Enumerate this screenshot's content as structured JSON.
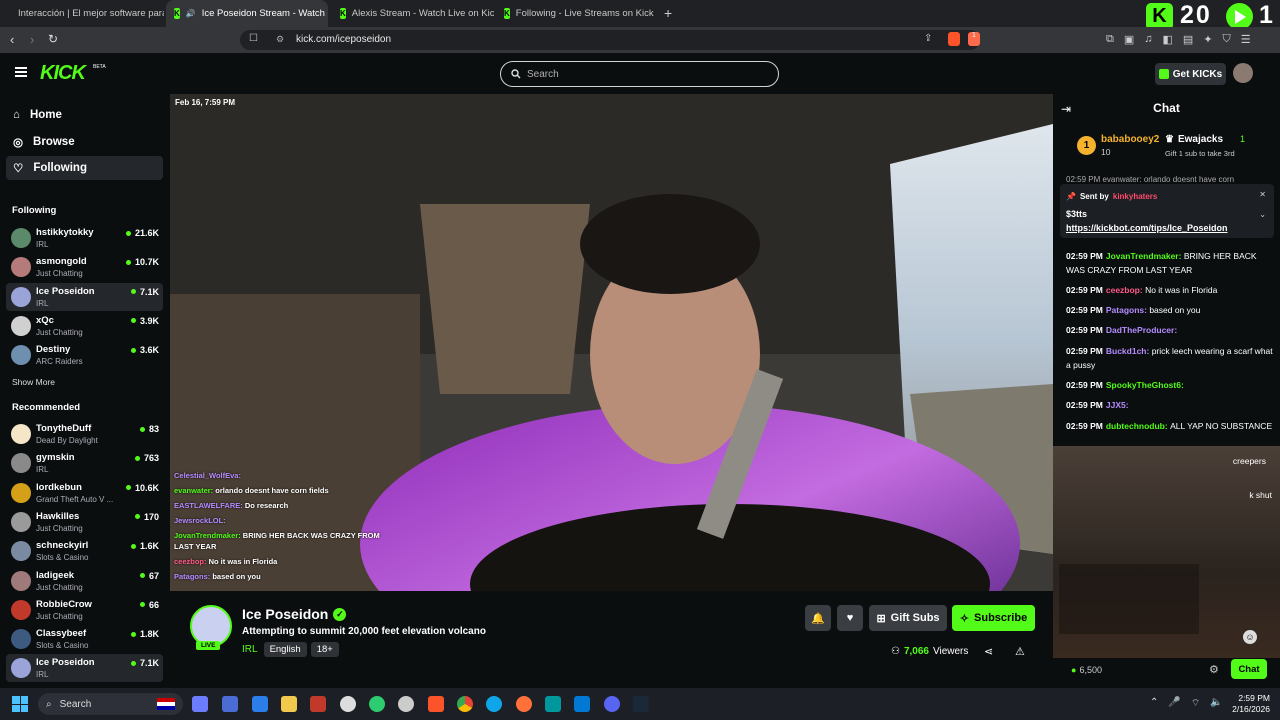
{
  "tabs": [
    {
      "title": "Interacción | El mejor software para y"
    },
    {
      "title": "Ice Poseidon Stream - Watch"
    },
    {
      "title": "Alexis Stream - Watch Live on Kick"
    },
    {
      "title": "Following - Live Streams on Kick"
    }
  ],
  "overlay_counter": "20",
  "overlay_counter2": "1",
  "url": "kick.com/iceposeidon",
  "ext_badge": "1",
  "site": {
    "logo": "KICK",
    "logo_sup": "BETA",
    "search_placeholder": "Search",
    "get_kicks": "Get KICKs"
  },
  "nav": {
    "home": "Home",
    "browse": "Browse",
    "following": "Following"
  },
  "following_title": "Following",
  "following": [
    {
      "name": "hstikkytokky",
      "sub": "IRL",
      "viewers": "21.6K",
      "color": "#5a8a6a"
    },
    {
      "name": "asmongold",
      "sub": "Just Chatting",
      "viewers": "10.7K",
      "color": "#b57b7b"
    },
    {
      "name": "Ice Poseidon",
      "sub": "IRL",
      "viewers": "7.1K",
      "color": "#9aa4d8"
    },
    {
      "name": "xQc",
      "sub": "Just Chatting",
      "viewers": "3.9K",
      "color": "#d0d0d0"
    },
    {
      "name": "Destiny",
      "sub": "ARC Raiders",
      "viewers": "3.6K",
      "color": "#6f8fb0"
    }
  ],
  "show_more": "Show More",
  "recommended_title": "Recommended",
  "recommended": [
    {
      "name": "TonytheDuff",
      "sub": "Dead By Daylight",
      "viewers": "83",
      "color": "#f5e6c8"
    },
    {
      "name": "gymskin",
      "sub": "IRL",
      "viewers": "763",
      "color": "#8a8a8a"
    },
    {
      "name": "lordkebun",
      "sub": "Grand Theft Auto V ...",
      "viewers": "10.6K",
      "color": "#d4a017"
    },
    {
      "name": "Hawkilles",
      "sub": "Just Chatting",
      "viewers": "170",
      "color": "#9a9a9a"
    },
    {
      "name": "schneckyirl",
      "sub": "Slots & Casino",
      "viewers": "1.6K",
      "color": "#7a8aa0"
    },
    {
      "name": "ladigeek",
      "sub": "Just Chatting",
      "viewers": "67",
      "color": "#a07a7a"
    },
    {
      "name": "RobbieCrow",
      "sub": "Just Chatting",
      "viewers": "66",
      "color": "#c0392b"
    },
    {
      "name": "Classybeef",
      "sub": "Slots & Casino",
      "viewers": "1.8K",
      "color": "#3d5a80"
    },
    {
      "name": "Ice Poseidon",
      "sub": "IRL",
      "viewers": "7.1K",
      "color": "#9aa4d8"
    }
  ],
  "video": {
    "timestamp": "Feb 16, 7:59 PM",
    "overlay_chat": [
      {
        "user": "Celestial_WolfEva:",
        "msg": "",
        "color": "#b58cff"
      },
      {
        "user": "evanwater:",
        "msg": "orlando doesnt have corn fields",
        "color": "#53fc18"
      },
      {
        "user": "EASTLAWELFARE:",
        "msg": "Do research",
        "color": "#b58cff"
      },
      {
        "user": "JewsrockLOL:",
        "msg": "",
        "color": "#b58cff"
      },
      {
        "user": "JovanTrendmaker:",
        "msg": "BRING HER BACK WAS CRAZY FROM LAST YEAR",
        "color": "#53fc18"
      },
      {
        "user": "ceezbop:",
        "msg": "No it was in Florida",
        "color": "#ff5a8a"
      },
      {
        "user": "Patagons:",
        "msg": "based on you",
        "color": "#b58cff"
      }
    ]
  },
  "stream": {
    "name": "Ice Poseidon",
    "title": "Attempting to summit 20,000 feet elevation volcano",
    "category": "IRL",
    "tags": [
      "English",
      "18+"
    ],
    "live": "LIVE",
    "gift_subs": "Gift Subs",
    "subscribe": "Subscribe",
    "viewers": "7,066",
    "viewers_label": "Viewers"
  },
  "chat": {
    "title": "Chat",
    "leader1_name": "bababooey2",
    "leader1_rank": "1",
    "leader1_count": "10",
    "leader2_name": "Ewajacks",
    "leader2_count": "1",
    "leader2_sub": "Gift 1 sub to take 3rd",
    "top_partial": "02:59 PM evanwater: orlando doesnt have corn",
    "pinned_sent_by": "Sent by",
    "pinned_user": "kinkyhaters",
    "pinned_amount": "$3tts",
    "pinned_link": "https://kickbot.com/tips/Ice_Poseidon",
    "messages": [
      {
        "time": "02:59 PM",
        "user": "JovanTrendmaker:",
        "msg": "BRING HER BACK WAS CRAZY FROM LAST YEAR",
        "color": "#53fc18"
      },
      {
        "time": "02:59 PM",
        "user": "ceezbop:",
        "msg": "No it was in Florida",
        "color": "#ff5a8a"
      },
      {
        "time": "02:59 PM",
        "user": "Patagons:",
        "msg": "based on you",
        "color": "#b58cff"
      },
      {
        "time": "02:59 PM",
        "user": "DadTheProducer:",
        "msg": "",
        "color": "#b58cff"
      },
      {
        "time": "02:59 PM",
        "user": "Buckd1ch:",
        "msg": "prick leech wearing a scarf what a pussy",
        "color": "#b58cff"
      },
      {
        "time": "02:59 PM",
        "user": "SpookyTheGhost6:",
        "msg": "",
        "color": "#53fc18"
      },
      {
        "time": "02:59 PM",
        "user": "JJX5:",
        "msg": "",
        "color": "#b58cff"
      },
      {
        "time": "02:59 PM",
        "user": "dubtechnodub:",
        "msg": "ALL YAP NO SUBSTANCE",
        "color": "#53fc18"
      }
    ],
    "partial1": "creepers",
    "partial2": "k shut",
    "points": "6,500",
    "chat_button": "Chat"
  },
  "taskbar": {
    "search": "Search",
    "time": "2:59 PM",
    "date": "2/16/2026"
  }
}
